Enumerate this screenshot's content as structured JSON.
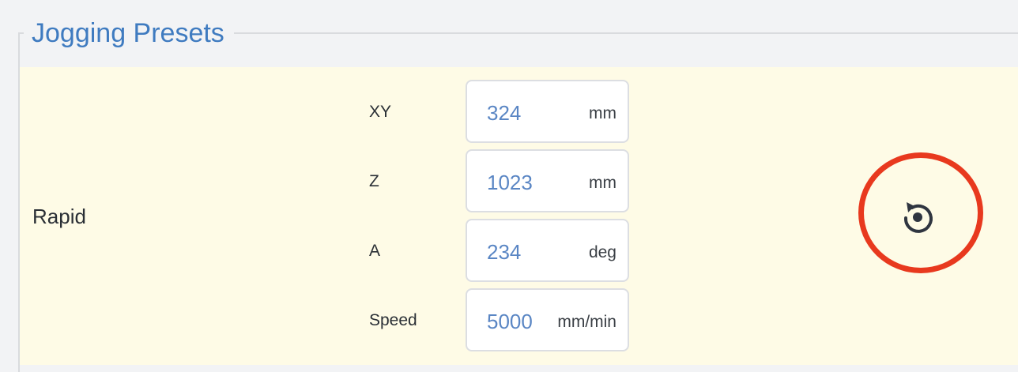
{
  "section": {
    "title": "Jogging Presets"
  },
  "preset": {
    "name": "Rapid",
    "fields": [
      {
        "label": "XY",
        "value": "324",
        "unit": "mm"
      },
      {
        "label": "Z",
        "value": "1023",
        "unit": "mm"
      },
      {
        "label": "A",
        "value": "234",
        "unit": "deg"
      },
      {
        "label": "Speed",
        "value": "5000",
        "unit": "mm/min"
      }
    ]
  },
  "icons": {
    "reset": "reset-icon"
  },
  "colors": {
    "accent_blue": "#3f7bc0",
    "value_blue": "#5a86c4",
    "panel_bg": "#fefbe6",
    "highlight_ring": "#e8391e"
  }
}
